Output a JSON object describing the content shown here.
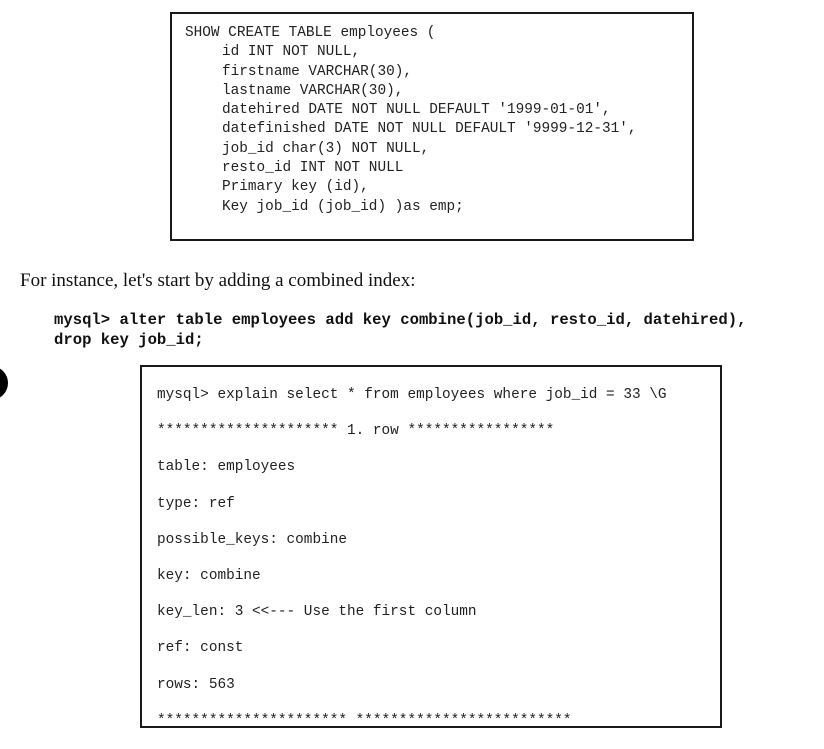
{
  "create_table_box": {
    "lines": [
      {
        "text": "SHOW CREATE TABLE employees (",
        "indent": false
      },
      {
        "text": "id INT NOT NULL,",
        "indent": true
      },
      {
        "text": "firstname VARCHAR(30),",
        "indent": true
      },
      {
        "text": "lastname VARCHAR(30),",
        "indent": true
      },
      {
        "text": "datehired DATE NOT NULL DEFAULT '1999-01-01',",
        "indent": true
      },
      {
        "text": "datefinished DATE NOT NULL DEFAULT '9999-12-31',",
        "indent": true
      },
      {
        "text": "job_id char(3) NOT NULL,",
        "indent": true
      },
      {
        "text": "resto_id INT NOT NULL",
        "indent": true
      },
      {
        "text": "Primary key (id),",
        "indent": true
      },
      {
        "text": "Key job_id (job_id) )as emp;",
        "indent": true
      }
    ]
  },
  "paragraph": "For instance, let's start by adding a combined index:",
  "command": {
    "line1": "mysql> alter table employees add key combine(job_id, resto_id, datehired),",
    "line2": "drop key job_id;"
  },
  "explain_box": {
    "lines": [
      "mysql> explain select * from employees where job_id = 33 \\G",
      "********************* 1. row *****************",
      "table: employees",
      "type: ref",
      "possible_keys: combine",
      "key: combine",
      "key_len: 3 <<--- Use the first column",
      "ref: const",
      "rows: 563",
      "********************** *************************"
    ]
  }
}
